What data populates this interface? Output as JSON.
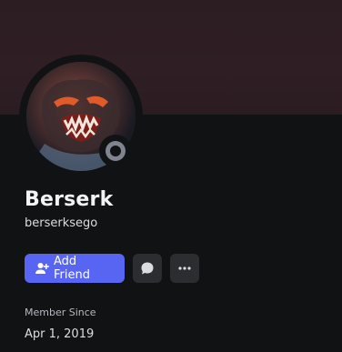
{
  "profile": {
    "display_name": "Berserk",
    "username": "berserksego",
    "status": "offline",
    "status_color": "#80848e",
    "banner_color": "#2c1d22",
    "avatar_icon": "berserk-avatar-image"
  },
  "actions": {
    "add_friend_label": "Add Friend",
    "add_friend_icon": "add-friend-icon",
    "message_icon": "message-bubble-icon",
    "more_icon": "more-dots-icon",
    "accent_color": "#5865f2"
  },
  "member_since": {
    "label": "Member Since",
    "value": "Apr 1, 2019"
  }
}
